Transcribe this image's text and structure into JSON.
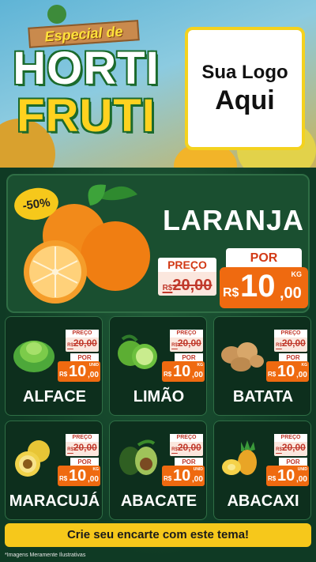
{
  "header": {
    "tag": "Especial de",
    "title_line1": "HORTI",
    "title_line2": "FRUTI",
    "logo_line1": "Sua Logo",
    "logo_line2": "Aqui"
  },
  "feature": {
    "discount": "-50%",
    "name": "LARANJA",
    "old_label": "PREÇO",
    "old_currency": "R$",
    "old_price": "20,00",
    "new_label": "POR",
    "new_currency": "R$",
    "new_int": "10",
    "new_dec": ",00",
    "unit": "KG"
  },
  "products": [
    {
      "name": "ALFACE",
      "old_label": "PREÇO",
      "old_currency": "R$",
      "old_price": "20,00",
      "new_label": "POR",
      "currency": "R$",
      "int": "10",
      "dec": ",00",
      "unit": "UNID"
    },
    {
      "name": "LIMÃO",
      "old_label": "PREÇO",
      "old_currency": "R$",
      "old_price": "20,00",
      "new_label": "POR",
      "currency": "R$",
      "int": "10",
      "dec": ",00",
      "unit": "KG"
    },
    {
      "name": "BATATA",
      "old_label": "PREÇO",
      "old_currency": "R$",
      "old_price": "20,00",
      "new_label": "POR",
      "currency": "R$",
      "int": "10",
      "dec": ",00",
      "unit": "KG"
    },
    {
      "name": "MARACUJÁ",
      "old_label": "PREÇO",
      "old_currency": "R$",
      "old_price": "20,00",
      "new_label": "POR",
      "currency": "R$",
      "int": "10",
      "dec": ",00",
      "unit": "KG"
    },
    {
      "name": "ABACATE",
      "old_label": "PREÇO",
      "old_currency": "R$",
      "old_price": "20,00",
      "new_label": "POR",
      "currency": "R$",
      "int": "10",
      "dec": ",00",
      "unit": "UNID"
    },
    {
      "name": "ABACAXI",
      "old_label": "PREÇO",
      "old_currency": "R$",
      "old_price": "20,00",
      "new_label": "POR",
      "currency": "R$",
      "int": "10",
      "dec": ",00",
      "unit": "UNID"
    }
  ],
  "cta": "Crie seu encarte com este tema!",
  "disclaimer": "*Imagens Meramente Ilustrativas"
}
